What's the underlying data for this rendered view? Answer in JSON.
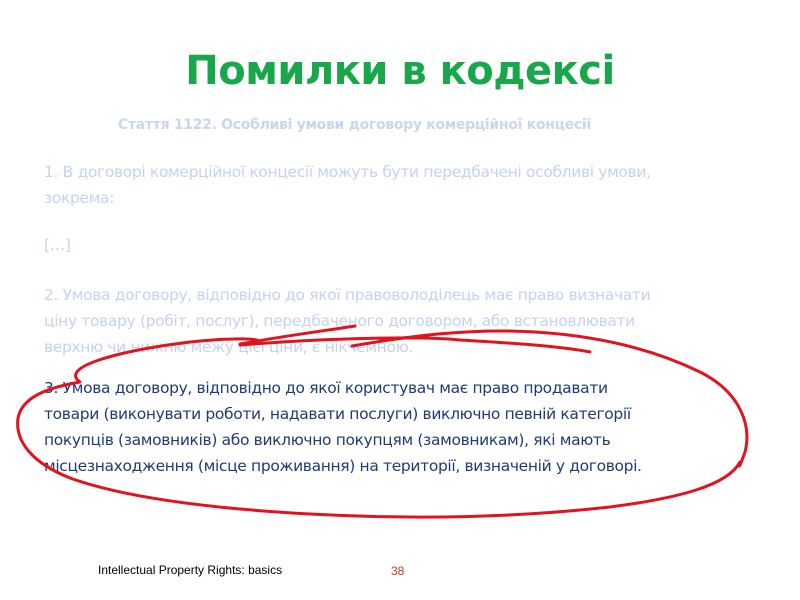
{
  "slide": {
    "title": "Помилки в кодексі",
    "article_heading": "Стаття 1122.  Особливі умови договору комерційної концесії",
    "paragraph_1": [
      "1. В договорі комерційної концесії можуть бути передбачені особливі умови,",
      "зокрема:"
    ],
    "ellipsis": "[…]",
    "paragraph_2": [
      "2. Умова договору, відповідно до якої правоволоділець має право визначати",
      "ціну товару (робіт, послуг), передбаченого договором, або встановлювати",
      "верхню чи нижню межу цієї ціни, є нікчемною."
    ],
    "paragraph_3": [
      "3. Умова договору, відповідно до якої користувач має право продавати",
      "товари (виконувати роботи, надавати послуги) виключно певній категорії",
      "покупців (замовників) або виключно покупцям (замовникам), які мають",
      "місцезнаходження (місце проживання) на території, визначеній у договорі."
    ]
  },
  "footer": {
    "text": "Intellectual Property Rights: basics",
    "page_number": "38"
  },
  "colors": {
    "title": "#1aa64a",
    "faded_text": "#c4d3ec",
    "highlighted_text": "#1f3a7a",
    "annotation": "#e0141e",
    "page_number": "#c0392b"
  }
}
